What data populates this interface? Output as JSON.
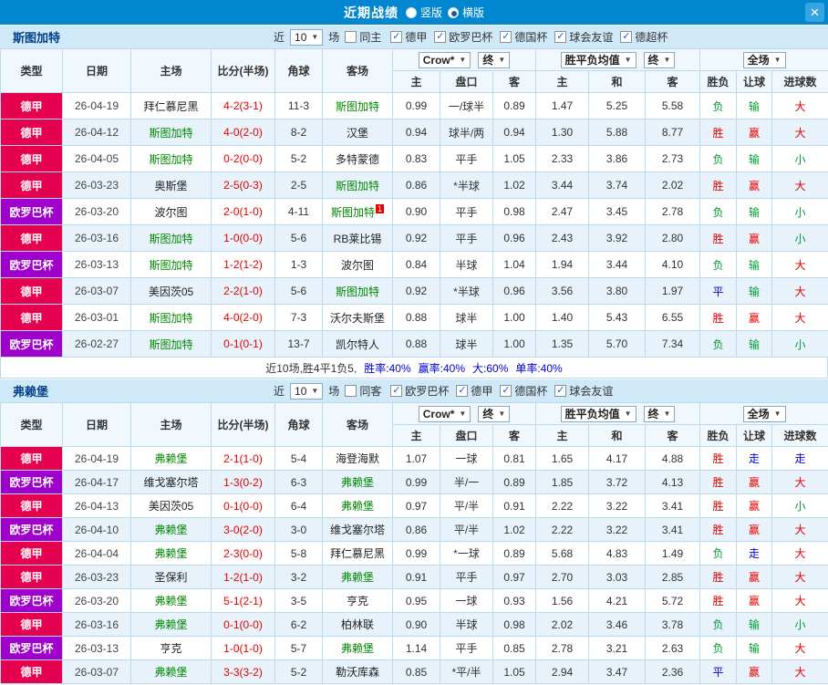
{
  "icons": {
    "close": "✕",
    "dropdown": "▼",
    "check": "✓"
  },
  "colors": {
    "topbar": "#0087cf",
    "league": {
      "德甲": "#e50050",
      "欧罗巴杯": "#a000cc"
    },
    "focus_team": "#008800",
    "score": "#e60000",
    "result": {
      "r": "#e60000",
      "g": "#009933",
      "b": "#0000dd"
    },
    "stat_blue": "#0000dd"
  },
  "titlebar": {
    "title": "近期战绩",
    "radios": [
      {
        "name": "vertical",
        "label": "竖版",
        "selected": false
      },
      {
        "name": "horizontal",
        "label": "横版",
        "selected": true
      }
    ]
  },
  "labels": {
    "near": "近",
    "count": "10",
    "games": "场"
  },
  "table_header": {
    "type": "类型",
    "date": "日期",
    "home": "主场",
    "score": "比分(半场)",
    "corner": "角球",
    "away": "客场",
    "odds_source": "Crow*",
    "final": "终",
    "avg": "胜平负均值",
    "full": "全场",
    "sub": [
      "主",
      "盘口",
      "客",
      "主",
      "和",
      "客",
      "胜负",
      "让球",
      "进球数"
    ]
  },
  "sections": [
    {
      "team": "斯图加特",
      "filter": {
        "same_label": "同主",
        "same_checked": false,
        "leagues": [
          "德甲",
          "欧罗巴杯",
          "德国杯",
          "球会友谊",
          "德超杯"
        ]
      },
      "rows": [
        {
          "league": "德甲",
          "date": "26-04-19",
          "home": "拜仁慕尼黑",
          "hf": false,
          "score": "4-2(3-1)",
          "corner": "11-3",
          "away": "斯图加特",
          "af": true,
          "w": "0.99",
          "hcap": "一/球半",
          "l": "0.89",
          "m1": "1.47",
          "m2": "5.25",
          "m3": "5.58",
          "res": "负",
          "resc": "g",
          "bet": "输",
          "betc": "g",
          "big": "大",
          "bigc": "r"
        },
        {
          "league": "德甲",
          "date": "26-04-12",
          "home": "斯图加特",
          "hf": true,
          "score": "4-0(2-0)",
          "corner": "8-2",
          "away": "汉堡",
          "af": false,
          "w": "0.94",
          "hcap": "球半/两",
          "l": "0.94",
          "m1": "1.30",
          "m2": "5.88",
          "m3": "8.77",
          "res": "胜",
          "resc": "r",
          "bet": "赢",
          "betc": "r",
          "big": "大",
          "bigc": "r"
        },
        {
          "league": "德甲",
          "date": "26-04-05",
          "home": "斯图加特",
          "hf": true,
          "score": "0-2(0-0)",
          "corner": "5-2",
          "away": "多特蒙德",
          "af": false,
          "w": "0.83",
          "hcap": "平手",
          "l": "1.05",
          "m1": "2.33",
          "m2": "3.86",
          "m3": "2.73",
          "res": "负",
          "resc": "g",
          "bet": "输",
          "betc": "g",
          "big": "小",
          "bigc": "g"
        },
        {
          "league": "德甲",
          "date": "26-03-23",
          "home": "奥斯堡",
          "hf": false,
          "score": "2-5(0-3)",
          "corner": "2-5",
          "away": "斯图加特",
          "af": true,
          "w": "0.86",
          "hcap": "*半球",
          "l": "1.02",
          "m1": "3.44",
          "m2": "3.74",
          "m3": "2.02",
          "res": "胜",
          "resc": "r",
          "bet": "赢",
          "betc": "r",
          "big": "大",
          "bigc": "r"
        },
        {
          "league": "欧罗巴杯",
          "date": "26-03-20",
          "home": "波尔图",
          "hf": false,
          "score": "2-0(1-0)",
          "corner": "4-11",
          "away": "斯图加特",
          "af": true,
          "sup": "1",
          "w": "0.90",
          "hcap": "平手",
          "l": "0.98",
          "m1": "2.47",
          "m2": "3.45",
          "m3": "2.78",
          "res": "负",
          "resc": "g",
          "bet": "输",
          "betc": "g",
          "big": "小",
          "bigc": "g"
        },
        {
          "league": "德甲",
          "date": "26-03-16",
          "home": "斯图加特",
          "hf": true,
          "score": "1-0(0-0)",
          "corner": "5-6",
          "away": "RB莱比锡",
          "af": false,
          "w": "0.92",
          "hcap": "平手",
          "l": "0.96",
          "m1": "2.43",
          "m2": "3.92",
          "m3": "2.80",
          "res": "胜",
          "resc": "r",
          "bet": "赢",
          "betc": "r",
          "big": "小",
          "bigc": "g"
        },
        {
          "league": "欧罗巴杯",
          "date": "26-03-13",
          "home": "斯图加特",
          "hf": true,
          "score": "1-2(1-2)",
          "corner": "1-3",
          "away": "波尔图",
          "af": false,
          "w": "0.84",
          "hcap": "半球",
          "l": "1.04",
          "m1": "1.94",
          "m2": "3.44",
          "m3": "4.10",
          "res": "负",
          "resc": "g",
          "bet": "输",
          "betc": "g",
          "big": "大",
          "bigc": "r"
        },
        {
          "league": "德甲",
          "date": "26-03-07",
          "home": "美因茨05",
          "hf": false,
          "score": "2-2(1-0)",
          "corner": "5-6",
          "away": "斯图加特",
          "af": true,
          "w": "0.92",
          "hcap": "*半球",
          "l": "0.96",
          "m1": "3.56",
          "m2": "3.80",
          "m3": "1.97",
          "res": "平",
          "resc": "b",
          "bet": "输",
          "betc": "g",
          "big": "大",
          "bigc": "r"
        },
        {
          "league": "德甲",
          "date": "26-03-01",
          "home": "斯图加特",
          "hf": true,
          "score": "4-0(2-0)",
          "corner": "7-3",
          "away": "沃尔夫斯堡",
          "af": false,
          "w": "0.88",
          "hcap": "球半",
          "l": "1.00",
          "m1": "1.40",
          "m2": "5.43",
          "m3": "6.55",
          "res": "胜",
          "resc": "r",
          "bet": "赢",
          "betc": "r",
          "big": "大",
          "bigc": "r"
        },
        {
          "league": "欧罗巴杯",
          "date": "26-02-27",
          "home": "斯图加特",
          "hf": true,
          "score": "0-1(0-1)",
          "corner": "13-7",
          "away": "凯尔特人",
          "af": false,
          "w": "0.88",
          "hcap": "球半",
          "l": "1.00",
          "m1": "1.35",
          "m2": "5.70",
          "m3": "7.34",
          "res": "负",
          "resc": "g",
          "bet": "输",
          "betc": "g",
          "big": "小",
          "bigc": "g"
        }
      ],
      "summary": {
        "prefix": "近10场,胜4平1负5,",
        "stats": [
          "胜率:40%",
          "赢率:40%",
          "大:60%",
          "单率:40%"
        ]
      }
    },
    {
      "team": "弗赖堡",
      "filter": {
        "same_label": "同客",
        "same_checked": false,
        "leagues": [
          "欧罗巴杯",
          "德甲",
          "德国杯",
          "球会友谊"
        ]
      },
      "rows": [
        {
          "league": "德甲",
          "date": "26-04-19",
          "home": "弗赖堡",
          "hf": true,
          "score": "2-1(1-0)",
          "corner": "5-4",
          "away": "海登海默",
          "af": false,
          "w": "1.07",
          "hcap": "一球",
          "l": "0.81",
          "m1": "1.65",
          "m2": "4.17",
          "m3": "4.88",
          "res": "胜",
          "resc": "r",
          "bet": "走",
          "betc": "b",
          "big": "走",
          "bigc": "b"
        },
        {
          "league": "欧罗巴杯",
          "date": "26-04-17",
          "home": "维戈塞尔塔",
          "hf": false,
          "score": "1-3(0-2)",
          "corner": "6-3",
          "away": "弗赖堡",
          "af": true,
          "w": "0.99",
          "hcap": "半/一",
          "l": "0.89",
          "m1": "1.85",
          "m2": "3.72",
          "m3": "4.13",
          "res": "胜",
          "resc": "r",
          "bet": "赢",
          "betc": "r",
          "big": "大",
          "bigc": "r"
        },
        {
          "league": "德甲",
          "date": "26-04-13",
          "home": "美因茨05",
          "hf": false,
          "score": "0-1(0-0)",
          "corner": "6-4",
          "away": "弗赖堡",
          "af": true,
          "w": "0.97",
          "hcap": "平/半",
          "l": "0.91",
          "m1": "2.22",
          "m2": "3.22",
          "m3": "3.41",
          "res": "胜",
          "resc": "r",
          "bet": "赢",
          "betc": "r",
          "big": "小",
          "bigc": "g"
        },
        {
          "league": "欧罗巴杯",
          "date": "26-04-10",
          "home": "弗赖堡",
          "hf": true,
          "score": "3-0(2-0)",
          "corner": "3-0",
          "away": "维戈塞尔塔",
          "af": false,
          "w": "0.86",
          "hcap": "平/半",
          "l": "1.02",
          "m1": "2.22",
          "m2": "3.22",
          "m3": "3.41",
          "res": "胜",
          "resc": "r",
          "bet": "赢",
          "betc": "r",
          "big": "大",
          "bigc": "r"
        },
        {
          "league": "德甲",
          "date": "26-04-04",
          "home": "弗赖堡",
          "hf": true,
          "score": "2-3(0-0)",
          "corner": "5-8",
          "away": "拜仁慕尼黑",
          "af": false,
          "w": "0.99",
          "hcap": "*一球",
          "l": "0.89",
          "m1": "5.68",
          "m2": "4.83",
          "m3": "1.49",
          "res": "负",
          "resc": "g",
          "bet": "走",
          "betc": "b",
          "big": "大",
          "bigc": "r"
        },
        {
          "league": "德甲",
          "date": "26-03-23",
          "home": "圣保利",
          "hf": false,
          "score": "1-2(1-0)",
          "corner": "3-2",
          "away": "弗赖堡",
          "af": true,
          "w": "0.91",
          "hcap": "平手",
          "l": "0.97",
          "m1": "2.70",
          "m2": "3.03",
          "m3": "2.85",
          "res": "胜",
          "resc": "r",
          "bet": "赢",
          "betc": "r",
          "big": "大",
          "bigc": "r"
        },
        {
          "league": "欧罗巴杯",
          "date": "26-03-20",
          "home": "弗赖堡",
          "hf": true,
          "score": "5-1(2-1)",
          "corner": "3-5",
          "away": "亨克",
          "af": false,
          "w": "0.95",
          "hcap": "一球",
          "l": "0.93",
          "m1": "1.56",
          "m2": "4.21",
          "m3": "5.72",
          "res": "胜",
          "resc": "r",
          "bet": "赢",
          "betc": "r",
          "big": "大",
          "bigc": "r"
        },
        {
          "league": "德甲",
          "date": "26-03-16",
          "home": "弗赖堡",
          "hf": true,
          "score": "0-1(0-0)",
          "corner": "6-2",
          "away": "柏林联",
          "af": false,
          "w": "0.90",
          "hcap": "半球",
          "l": "0.98",
          "m1": "2.02",
          "m2": "3.46",
          "m3": "3.78",
          "res": "负",
          "resc": "g",
          "bet": "输",
          "betc": "g",
          "big": "小",
          "bigc": "g"
        },
        {
          "league": "欧罗巴杯",
          "date": "26-03-13",
          "home": "亨克",
          "hf": false,
          "score": "1-0(1-0)",
          "corner": "5-7",
          "away": "弗赖堡",
          "af": true,
          "w": "1.14",
          "hcap": "平手",
          "l": "0.85",
          "m1": "2.78",
          "m2": "3.21",
          "m3": "2.63",
          "res": "负",
          "resc": "g",
          "bet": "输",
          "betc": "g",
          "big": "大",
          "bigc": "r"
        },
        {
          "league": "德甲",
          "date": "26-03-07",
          "home": "弗赖堡",
          "hf": true,
          "score": "3-3(3-2)",
          "corner": "5-2",
          "away": "勒沃库森",
          "af": false,
          "w": "0.85",
          "hcap": "*平/半",
          "l": "1.05",
          "m1": "2.94",
          "m2": "3.47",
          "m3": "2.36",
          "res": "平",
          "resc": "b",
          "bet": "赢",
          "betc": "r",
          "big": "大",
          "bigc": "r"
        }
      ]
    }
  ]
}
